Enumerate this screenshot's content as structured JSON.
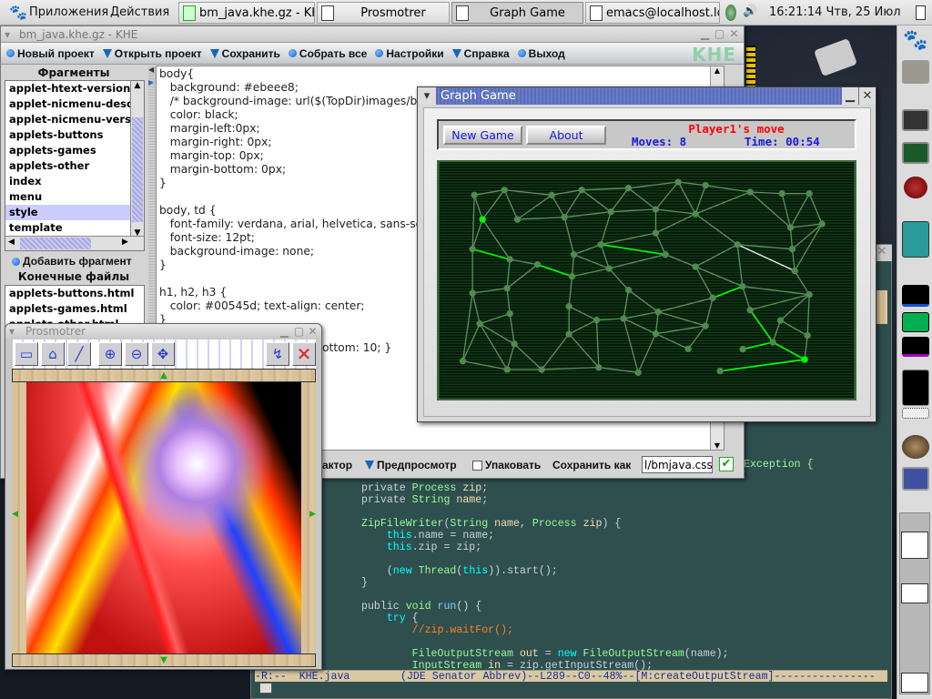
{
  "top_panel": {
    "applications": "Приложения",
    "actions": "Действия",
    "tasks": [
      "bm_java.khe.gz - KHE",
      "Prosmotrer",
      "Graph Game",
      "emacs@localhost.loca"
    ],
    "clock": "16:21:14 Чтв, 25 Июл"
  },
  "khe": {
    "title": "bm_java.khe.gz - KHE",
    "logo": "KHE",
    "toolbar": [
      "Новый проект",
      "Открыть проект",
      "Сохранить",
      "Собрать все",
      "Настройки",
      "Справка",
      "Выход"
    ],
    "fragments_header": "Фрагменты",
    "fragments": [
      "applet-htext-version",
      "applet-nicmenu-desc",
      "applet-nicmenu-versi",
      "applets-buttons",
      "applets-games",
      "applets-other",
      "index",
      "menu",
      "style",
      "template"
    ],
    "selected_fragment": "style",
    "add_fragment": "Добавить фрагмент",
    "output_header": "Конечные файлы",
    "output_files": [
      "applets-buttons.html",
      "applets-games.html",
      "applets-other.html"
    ],
    "editor_lines": [
      "body{",
      "   background: #ebeee8;",
      "   /* background-image: url($(TopDir)images/ba",
      "   color: black;",
      "   margin-left:0px;",
      "   margin-right: 0px;",
      "   margin-top: 0px;",
      "   margin-bottom: 0px;",
      "}",
      "",
      "body, td {",
      "   font-family: verdana, arial, helvetica, sans-ser",
      "   font-size: 12pt;",
      "   background-image: none;",
      "}",
      "",
      "h1, h2, h3 {",
      "   color: #00545d; text-align: center;",
      "}"
    ],
    "editor_fragment": "ottom: 10; }",
    "bottom": {
      "editor": "Редактор",
      "preview": "Предпросмотр",
      "pack": "Упаковать",
      "pack_checked": false,
      "save_as": "Сохранить как",
      "filename": "l/bmjava.css"
    }
  },
  "prosmotrer": {
    "title": "Prosmotrer",
    "tools": [
      "view-icon",
      "shape-icon",
      "line-icon",
      "zoom-in-icon",
      "zoom-out-icon",
      "move-icon",
      "effects-icon",
      "close-icon"
    ]
  },
  "graph_game": {
    "title": "Graph Game",
    "new_game": "New Game",
    "about": "About",
    "status": "Player1's move",
    "moves": "Moves: 8",
    "time": "Time: 00:54",
    "colors": {
      "status": "#ff0000",
      "info": "#1a1adc",
      "node": "#4f8a4f",
      "active": "#00ff00"
    }
  },
  "emacs": {
    "fragment": "Exception {",
    "modeline": "-R:--  KHE.java        (JDE Senator Abbrev)--L289--C0--48%--[M:createOutputStream]----------------"
  }
}
